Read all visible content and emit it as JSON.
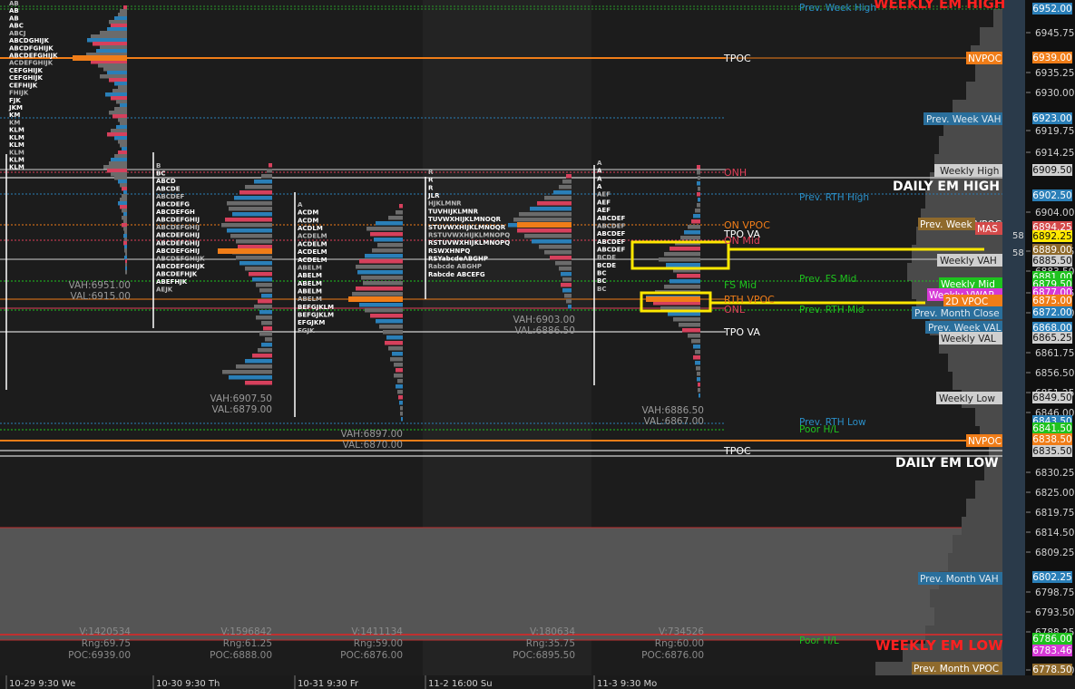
{
  "chart_data": {
    "type": "market-profile",
    "y_axis": {
      "ticks": [
        "6945.75",
        "6935.25",
        "6930.00",
        "6919.75",
        "6914.25",
        "6904.00",
        "6888.75",
        "6883.50",
        "6877.75",
        "6872.50",
        "6861.75",
        "6856.50",
        "6851.25",
        "6846.00",
        "6830.25",
        "6825.00",
        "6819.75",
        "6814.50",
        "6809.25",
        "6798.75",
        "6793.50",
        "6788.25",
        "6778.50"
      ],
      "ylim": [
        6776,
        6955
      ]
    },
    "x_axis": {
      "labels": [
        "10-29  9:30 We",
        "10-30  9:30 Th",
        "10-31  9:30 Fr",
        "11-2  16:00 Su",
        "11-3  9:30 Mo"
      ]
    },
    "sessions": [
      {
        "name": "10-29",
        "vah": "VAH:6951.00",
        "val": "VAL:6915.00",
        "v": "V:1420534",
        "rng": "Rng:69.75",
        "poc": "POC:6939.00",
        "letters_top": [
          "AB",
          "AB",
          "AB",
          "ABC",
          "ABCJ",
          "ABCDGHIJK",
          "ABCDFGHIJK",
          "ABCDEFGHIJK",
          "ACDEFGHIJK",
          "CEFGHIJK",
          "CEFGHIJK",
          "CEFHIJK",
          "FHIJK",
          "FJK",
          "JKM",
          "KM",
          "KM",
          "KLM",
          "KLM",
          "KLM",
          "KLM",
          "KLM",
          "KLM"
        ]
      },
      {
        "name": "10-30",
        "vah": "VAH:6907.50",
        "val": "VAL:6879.00",
        "v": "V:1596842",
        "rng": "Rng:61.25",
        "poc": "POC:6888.00",
        "letters_top": [
          "B",
          "BC",
          "ABCD",
          "ABCDE",
          "ABCDEF",
          "ABCDEFG",
          "ABCDEFGH",
          "ABCDEFGHIJ",
          "ABCDEFGHIJ",
          "ABCDEFGHIJ",
          "ABCDEFGHIJ",
          "ABCDEFGHIJ",
          "ABCDEFGHIJK",
          "ABCDEFGHIJK",
          "ABCDEFHJK",
          "ABEFHJK",
          "AEJK"
        ]
      },
      {
        "name": "10-31",
        "vah": "VAH:6897.00",
        "val": "VAL:6870.00",
        "v": "V:1411134",
        "rng": "Rng:59.00",
        "poc": "POC:6876.00",
        "letters_top": [
          "A",
          "ACDM",
          "ACDM",
          "ACDLM",
          "ACDELM",
          "ACDELM",
          "ACDELM",
          "ACDELM",
          "ABELM",
          "ABELM",
          "ABELM",
          "ABELM",
          "ABELM",
          "BEFGJKLM",
          "BEFGJKLM",
          "EFGJKM",
          "FGJK"
        ]
      },
      {
        "name": "11-2",
        "vah": "VAH:6903.00",
        "val": "VAL:6886.50",
        "v": "V:180634",
        "rng": "Rng:35.75",
        "poc": "POC:6895.50",
        "letters_top": [
          "R",
          "R",
          "R",
          "JLR",
          "HJKLMNR",
          "TUVHIJKLMNR",
          "TUVWXHIJKLMNOQR",
          "STUVWXHIJKLMNOQR",
          "RSTUVWXHIJKLMNOPQ",
          "RSTUVWXHIJKLMNOPQ",
          "RSWXHNPQ",
          "RSYabcdeABGHP",
          "Rabcde ABGHP",
          "Rabcde ABCEFG"
        ]
      },
      {
        "name": "11-3",
        "vah": "VAH:6886.50",
        "val": "VAL:6867.00",
        "v": "V:734526",
        "rng": "Rng:60.00",
        "poc": "POC:6876.00",
        "letters_top": [
          "A",
          "A",
          "A",
          "A",
          "AEF",
          "AEF",
          "AEF",
          "ABCDEF",
          "ABCDEF",
          "ABCDEF",
          "ABCDEF",
          "ABCDEF",
          "BCDE",
          "BCDE",
          "BC",
          "BC",
          "BC"
        ]
      }
    ],
    "line_labels": {
      "prev_week_high": "Prev. Week High",
      "weekly_em_high": "WEEKLY EM HIGH",
      "tpoc_top": "TPOC",
      "nvpoc_top": "NVPOC",
      "prev_week_vah": "Prev. Week VAH",
      "weekly_high": "Weekly High",
      "onh": "ONH",
      "daily_em_high": "DAILY EM HIGH",
      "prev_rth_high": "Prev. RTH High",
      "on_vpoc": "ON VPOC",
      "prev_week_poc": "Prev. Week VPOC",
      "mas": "MAS",
      "tpo_va_top": "TPO VA",
      "on_mid": "ON Mid",
      "weekly_vah": "Weekly VAH",
      "fs_mid": "FS Mid",
      "prev_fs_mid": "Prev. FS Mid",
      "weekly_mid": "Weekly Mid",
      "weekly_vwap": "Weekly VWAP",
      "rth_vpoc": "RTH VPOC",
      "vpoc_2d": "2D VPOC",
      "onl": "ONL",
      "prev_rth_mid": "Prev. RTH Mid",
      "prev_month_close": "Prev. Month Close",
      "tpo_va": "TPO VA",
      "prev_week_val": "Prev. Week VAL",
      "weekly_val": "Weekly VAL",
      "weekly_low": "Weekly Low",
      "prev_rth_low": "Prev. RTH Low",
      "poor_hl": "Poor H/L",
      "nvpoc_bottom": "NVPOC",
      "tpoc_bottom": "TPOC",
      "daily_em_low": "DAILY EM LOW",
      "prev_month_vah": "Prev. Month VAH",
      "poor_hl_bottom": "Poor H/L",
      "weekly_em_low": "WEEKLY EM LOW",
      "prev_month_vpoc": "Prev. Month VPOC"
    },
    "price_badges": [
      {
        "text": "6952.00",
        "color": "#2a7fb8"
      },
      {
        "text": "6939.00",
        "color": "#f07d18"
      },
      {
        "text": "6923.00",
        "color": "#2a7fb8"
      },
      {
        "text": "6909.50",
        "color": "#cfcfcf"
      },
      {
        "text": "6902.50",
        "color": "#2a7fb8"
      },
      {
        "text": "6894.25",
        "color": "#d44a4a"
      },
      {
        "text": "6892.25",
        "color": "#ffe800"
      },
      {
        "text": "6889.00",
        "color": "#8f6a2c"
      },
      {
        "text": "6885.50",
        "color": "#cfcfcf"
      },
      {
        "text": "6881.00",
        "color": "#1ec31e"
      },
      {
        "text": "6879.50",
        "color": "#1ec31e"
      },
      {
        "text": "6877.00",
        "color": "#d639d6"
      },
      {
        "text": "6875.00",
        "color": "#f07d18"
      },
      {
        "text": "6872.00",
        "color": "#2a7fb8"
      },
      {
        "text": "6868.00",
        "color": "#2a7fb8"
      },
      {
        "text": "6865.25",
        "color": "#cfcfcf"
      },
      {
        "text": "6849.50",
        "color": "#cfcfcf"
      },
      {
        "text": "6843.50",
        "color": "#2a7fb8"
      },
      {
        "text": "6841.50",
        "color": "#1ec31e"
      },
      {
        "text": "6838.50",
        "color": "#f07d18"
      },
      {
        "text": "6835.50",
        "color": "#cfcfcf"
      },
      {
        "text": "6802.25",
        "color": "#2a7fb8"
      },
      {
        "text": "6786.00",
        "color": "#1ec31e"
      },
      {
        "text": "6783.46",
        "color": "#d639d6"
      },
      {
        "text": "6778.50",
        "color": "#8f6a2c"
      }
    ],
    "cursor_value": "58",
    "colors": {
      "background": "#1c1c1c",
      "profile_gray": "#6b6b6b",
      "profile_blue": "#2a7fb8",
      "profile_red": "#d6405c",
      "orange": "#f07d18",
      "highlight": "#ffe800",
      "em_red": "#ff2020"
    }
  }
}
